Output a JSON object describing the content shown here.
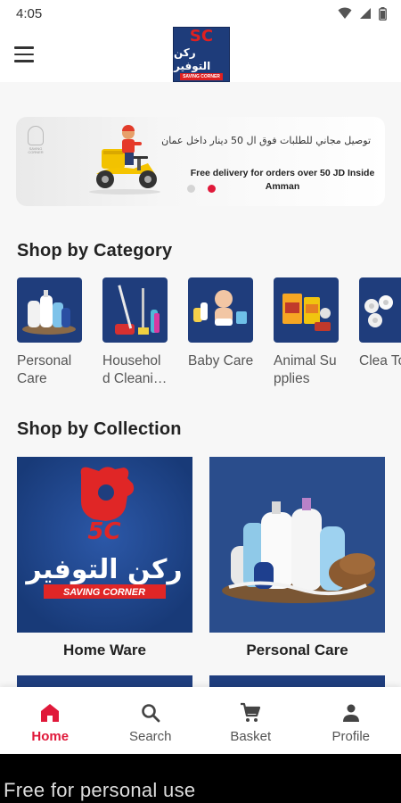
{
  "status_bar": {
    "time": "4:05"
  },
  "logo": {
    "arabic": "ركن التوفير",
    "english": "SAVING CORNER",
    "mark": "SC"
  },
  "banner": {
    "arabic_text": "توصيل مجاني للطلبات فوق ال 50 دينار داخل عمان",
    "english_text": "Free delivery for orders over 50 JD Inside Amman",
    "slides": 2,
    "active_slide": 2
  },
  "categories": {
    "title": "Shop by Category",
    "items": [
      {
        "label": "Personal Care"
      },
      {
        "label": "Household Cleani…"
      },
      {
        "label": "Baby Care"
      },
      {
        "label": "Animal Supplies"
      },
      {
        "label": "Clea Tow"
      }
    ]
  },
  "collections": {
    "title": "Shop by Collection",
    "items": [
      {
        "label": "Home Ware"
      },
      {
        "label": "Personal Care"
      }
    ]
  },
  "bottom_nav": {
    "items": [
      {
        "label": "Home",
        "icon": "home-icon",
        "active": true
      },
      {
        "label": "Search",
        "icon": "search-icon",
        "active": false
      },
      {
        "label": "Basket",
        "icon": "cart-icon",
        "active": false
      },
      {
        "label": "Profile",
        "icon": "person-icon",
        "active": false
      }
    ]
  },
  "colors": {
    "accent": "#e0193a",
    "brand_blue": "#1f3d7c",
    "brand_red": "#e02020"
  },
  "watermark": "Free for personal use"
}
